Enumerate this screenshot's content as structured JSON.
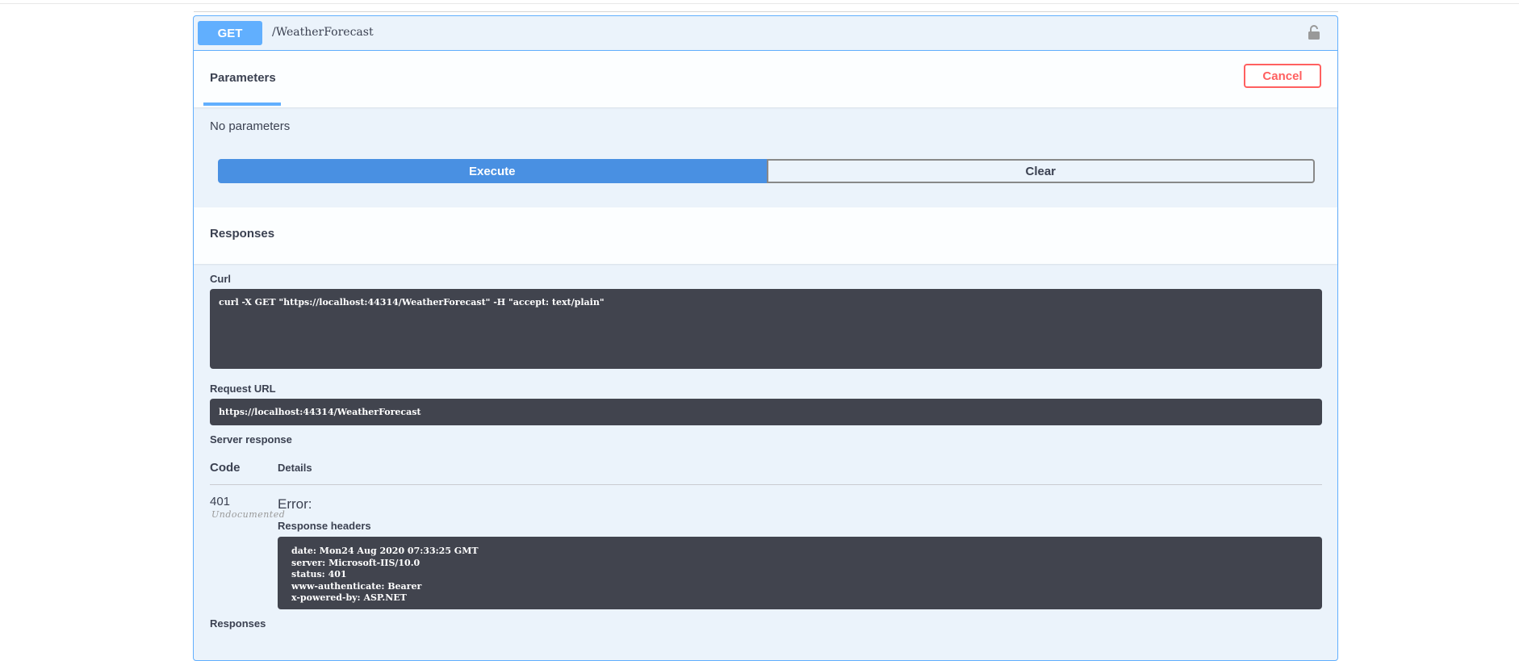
{
  "operation": {
    "method": "GET",
    "path": "/WeatherForecast"
  },
  "parameters": {
    "tab_label": "Parameters",
    "cancel_label": "Cancel",
    "empty_text": "No parameters"
  },
  "actions": {
    "execute_label": "Execute",
    "clear_label": "Clear"
  },
  "responses": {
    "title": "Responses",
    "curl_label": "Curl",
    "curl_command": "curl -X GET \"https://localhost:44314/WeatherForecast\" -H \"accept: text/plain\"",
    "request_url_label": "Request URL",
    "request_url": "https://localhost:44314/WeatherForecast",
    "server_response_label": "Server response",
    "code_header": "Code",
    "details_header": "Details",
    "status_code": "401",
    "undocumented_label": "Undocumented",
    "error_text": "Error:",
    "response_headers_label": "Response headers",
    "response_headers": [
      "date: Mon24 Aug 2020 07:33:25 GMT",
      "server: Microsoft-IIS/10.0",
      "status: 401",
      "www-authenticate: Bearer",
      "x-powered-by: ASP.NET"
    ],
    "footer_label": "Responses"
  },
  "colors": {
    "get_accent": "#61affe",
    "execute_bg": "#4990e2",
    "cancel": "#ff6060",
    "code_bg": "#41444e"
  },
  "icons": {
    "lock": "unlocked-lock-icon"
  }
}
